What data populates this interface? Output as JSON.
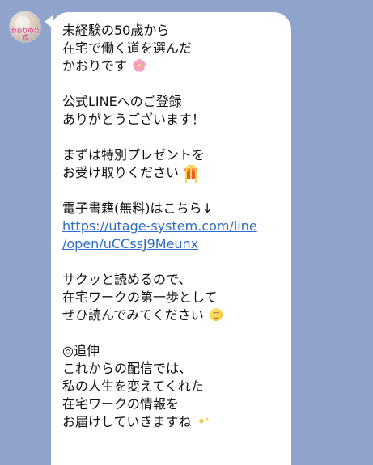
{
  "sender": {
    "avatar_label": "かおりの公式"
  },
  "message": {
    "lines": [
      "未経験の50歳から",
      "在宅で働く道を選んだ",
      "かおりです",
      "",
      "公式LINEへのご登録",
      "ありがとうございます！",
      "",
      "まずは特別プレゼントを",
      "お受け取りください",
      "",
      "電子書籍(無料)はこちら↓",
      "https://utage-system.com/line",
      "/open/uCCssJ9Meunx",
      "",
      "サクッと読めるので、",
      "在宅ワークの第一歩として",
      "ぜひ読んでみてください",
      "",
      "◎追伸",
      "これからの配信では、",
      "私の人生を変えてくれた",
      "在宅ワークの情報を",
      "お届けしていきますね"
    ],
    "emojis": {
      "line_3": "cherry-blossom-icon",
      "line_9": "gift-icon",
      "line_17": "relieved-face-icon",
      "line_23": "sparkles-icon"
    }
  },
  "colors": {
    "background": "#8fa3cb",
    "bubble": "#ffffff",
    "link": "#2f6cc7",
    "text": "#111111"
  }
}
